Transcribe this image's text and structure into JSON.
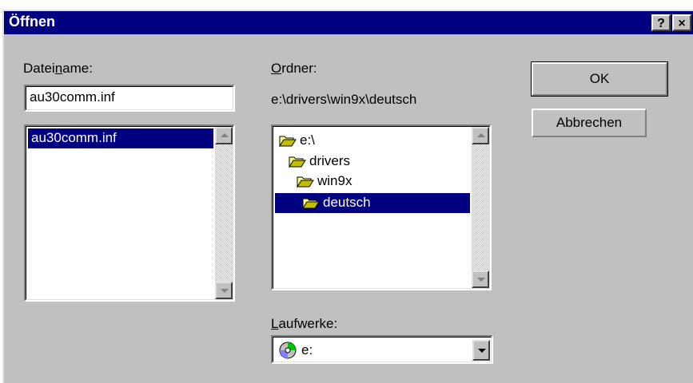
{
  "window": {
    "title": "Öffnen",
    "help_button": "?",
    "close_button": "×"
  },
  "filename": {
    "label_pre": "Datei",
    "label_accel": "n",
    "label_post": "ame:",
    "value": "au30comm.inf",
    "files": [
      "au30comm.inf"
    ],
    "selected_index": 0
  },
  "folder": {
    "label_accel": "O",
    "label_post": "rdner:",
    "current_path": "e:\\drivers\\win9x\\deutsch",
    "tree": [
      "e:\\",
      "drivers",
      "win9x",
      "deutsch"
    ],
    "selected_index": 3
  },
  "drives": {
    "label_accel": "L",
    "label_post": "aufwerke:",
    "value": "e:",
    "icon": "cd-drive-icon"
  },
  "buttons": {
    "ok": "OK",
    "cancel": "Abbrechen"
  },
  "colors": {
    "titlebar": "#000080",
    "selection": "#000080",
    "dialog_face": "#c0c0c0"
  }
}
